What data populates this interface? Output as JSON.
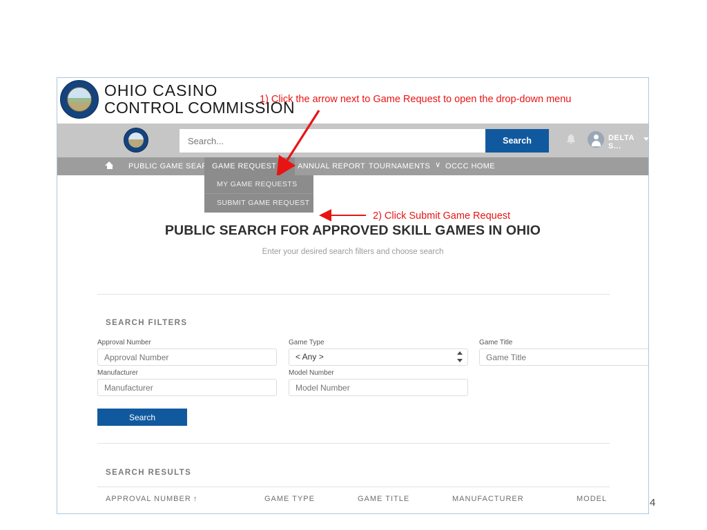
{
  "slide": {
    "number": "4"
  },
  "annotations": [
    {
      "text": "1)  Click the arrow next to Game Request to open the drop-down menu"
    },
    {
      "text": "2)  Click Submit Game Request"
    }
  ],
  "colors": {
    "brand_blue": "#11599f",
    "nav_gray": "#9d9d9d",
    "nav_active_gray": "#8c8c8c",
    "annotation_red": "#e81414",
    "frame_border": "#a9c7de"
  },
  "header": {
    "org_line1": "OHIO  CASINO",
    "org_line2": "CONTROL COMMISSION",
    "seal_icon": "ohio-casino-control-commission-seal"
  },
  "search_strip": {
    "seal_icon": "ohio-casino-control-commission-seal-small",
    "placeholder": "Search...",
    "value": "",
    "search_button": "Search",
    "bell_icon": "notification-bell-icon",
    "avatar_icon": "user-avatar-icon",
    "user_name": "DELTA S...",
    "caret_icon": "chevron-down-icon"
  },
  "nav": {
    "home_icon": "home-icon",
    "items": [
      {
        "label": "PUBLIC GAME SEARCH",
        "caret": "",
        "active": false
      },
      {
        "label": "GAME REQUEST",
        "caret": "∨",
        "active": true
      },
      {
        "label": "ANNUAL REPORT",
        "caret": "",
        "active": false
      },
      {
        "label": "TOURNAMENTS",
        "caret": "∨",
        "active": false
      },
      {
        "label": "OCCC HOME",
        "caret": "",
        "active": false
      }
    ]
  },
  "dropdown": {
    "items": [
      {
        "label": "MY GAME REQUESTS"
      },
      {
        "label": "SUBMIT GAME REQUEST"
      }
    ]
  },
  "page": {
    "title": "PUBLIC SEARCH FOR APPROVED SKILL GAMES IN OHIO",
    "subtitle": "Enter your desired search filters and choose search"
  },
  "filters": {
    "section_title": "SEARCH FILTERS",
    "fields": [
      {
        "label": "Approval Number",
        "placeholder": "Approval Number",
        "value": ""
      },
      {
        "label": "Game Type",
        "placeholder": "",
        "value": "< Any >"
      },
      {
        "label": "Game Title",
        "placeholder": "Game Title",
        "value": ""
      },
      {
        "label": "Manufacturer",
        "placeholder": "Manufacturer",
        "value": ""
      },
      {
        "label": "Model Number",
        "placeholder": "Model Number",
        "value": ""
      }
    ],
    "search_button": "Search"
  },
  "results": {
    "section_title": "SEARCH RESULTS",
    "columns": [
      {
        "label": "APPROVAL NUMBER",
        "sort": "↑"
      },
      {
        "label": "GAME TYPE",
        "sort": ""
      },
      {
        "label": "GAME TITLE",
        "sort": ""
      },
      {
        "label": "MANUFACTURER",
        "sort": ""
      },
      {
        "label": "MODEL",
        "sort": ""
      }
    ]
  }
}
